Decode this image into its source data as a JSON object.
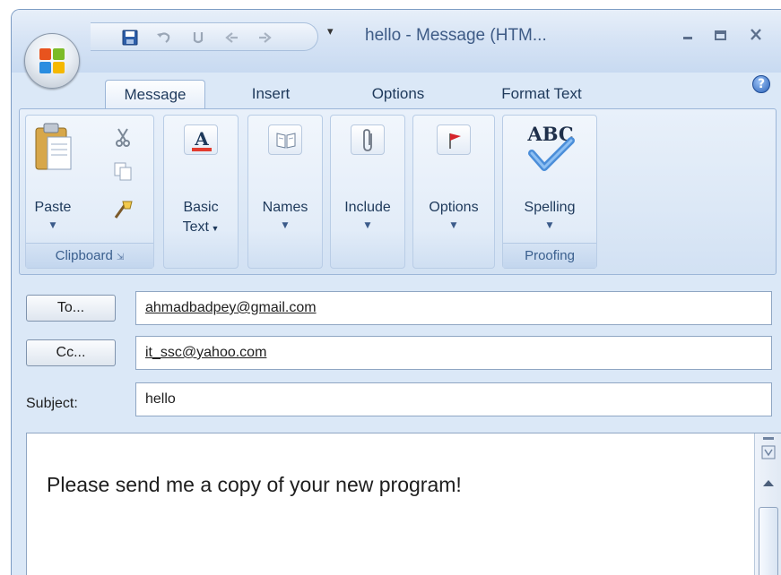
{
  "window": {
    "title": "hello - Message (HTM...",
    "qat_dropdown_glyph": "▾"
  },
  "tabs": [
    {
      "label": "Message",
      "active": true
    },
    {
      "label": "Insert",
      "active": false
    },
    {
      "label": "Options",
      "active": false
    },
    {
      "label": "Format Text",
      "active": false
    }
  ],
  "ribbon": {
    "clipboard": {
      "paste": "Paste",
      "group_label": "Clipboard"
    },
    "basic_text": {
      "line1": "Basic",
      "line2": "Text"
    },
    "names": {
      "label": "Names"
    },
    "include": {
      "label": "Include"
    },
    "options": {
      "label": "Options"
    },
    "proofing": {
      "spelling": "Spelling",
      "group_label": "Proofing",
      "abc": "ABC"
    }
  },
  "form": {
    "to_button": {
      "label": "To..."
    },
    "cc_button": {
      "label": "Cc..."
    },
    "to_value": "ahmadbadpey@gmail.com",
    "cc_value": "it_ssc@yahoo.com",
    "subject_label": "Subject:",
    "subject_value": "hello",
    "body_text": "Please send me a copy of your new program!"
  },
  "colors": {
    "accent": "#1e395b",
    "ribbon_bg": "#dce8f6"
  }
}
